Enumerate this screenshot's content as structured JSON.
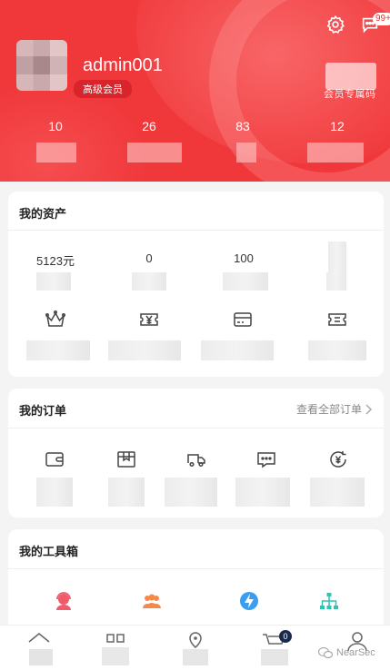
{
  "header": {
    "username": "admin001",
    "member_level": "高级会员",
    "message_badge": "99+",
    "member_card_label": "会员专属码",
    "stats": [
      {
        "value": "10"
      },
      {
        "value": "26"
      },
      {
        "value": "83"
      },
      {
        "value": "12"
      }
    ]
  },
  "assets": {
    "title": "我的资产",
    "values": [
      "5123元",
      "0",
      "100"
    ],
    "icons": [
      "crown-icon",
      "yuan-ticket-icon",
      "card-icon",
      "coupon-icon"
    ]
  },
  "orders": {
    "title": "我的订单",
    "see_all": "查看全部订单",
    "icons": [
      "wallet-icon",
      "package-icon",
      "truck-icon",
      "comment-icon",
      "refund-icon"
    ]
  },
  "toolbox": {
    "title": "我的工具箱",
    "icons": [
      "service-icon",
      "team-icon",
      "lightning-icon",
      "network-icon"
    ]
  },
  "tabbar": {
    "cart_count": "0",
    "icons": [
      "home-icon",
      "category-icon",
      "location-icon",
      "cart-icon",
      "profile-icon"
    ]
  },
  "watermark": "NearSec",
  "colors": {
    "brand_red": "#f0373a",
    "badge_red": "#d8242a",
    "teal": "#2cc5b0",
    "orange": "#f5894a",
    "blue": "#3a9ef0",
    "pink_red": "#f05a6a"
  }
}
